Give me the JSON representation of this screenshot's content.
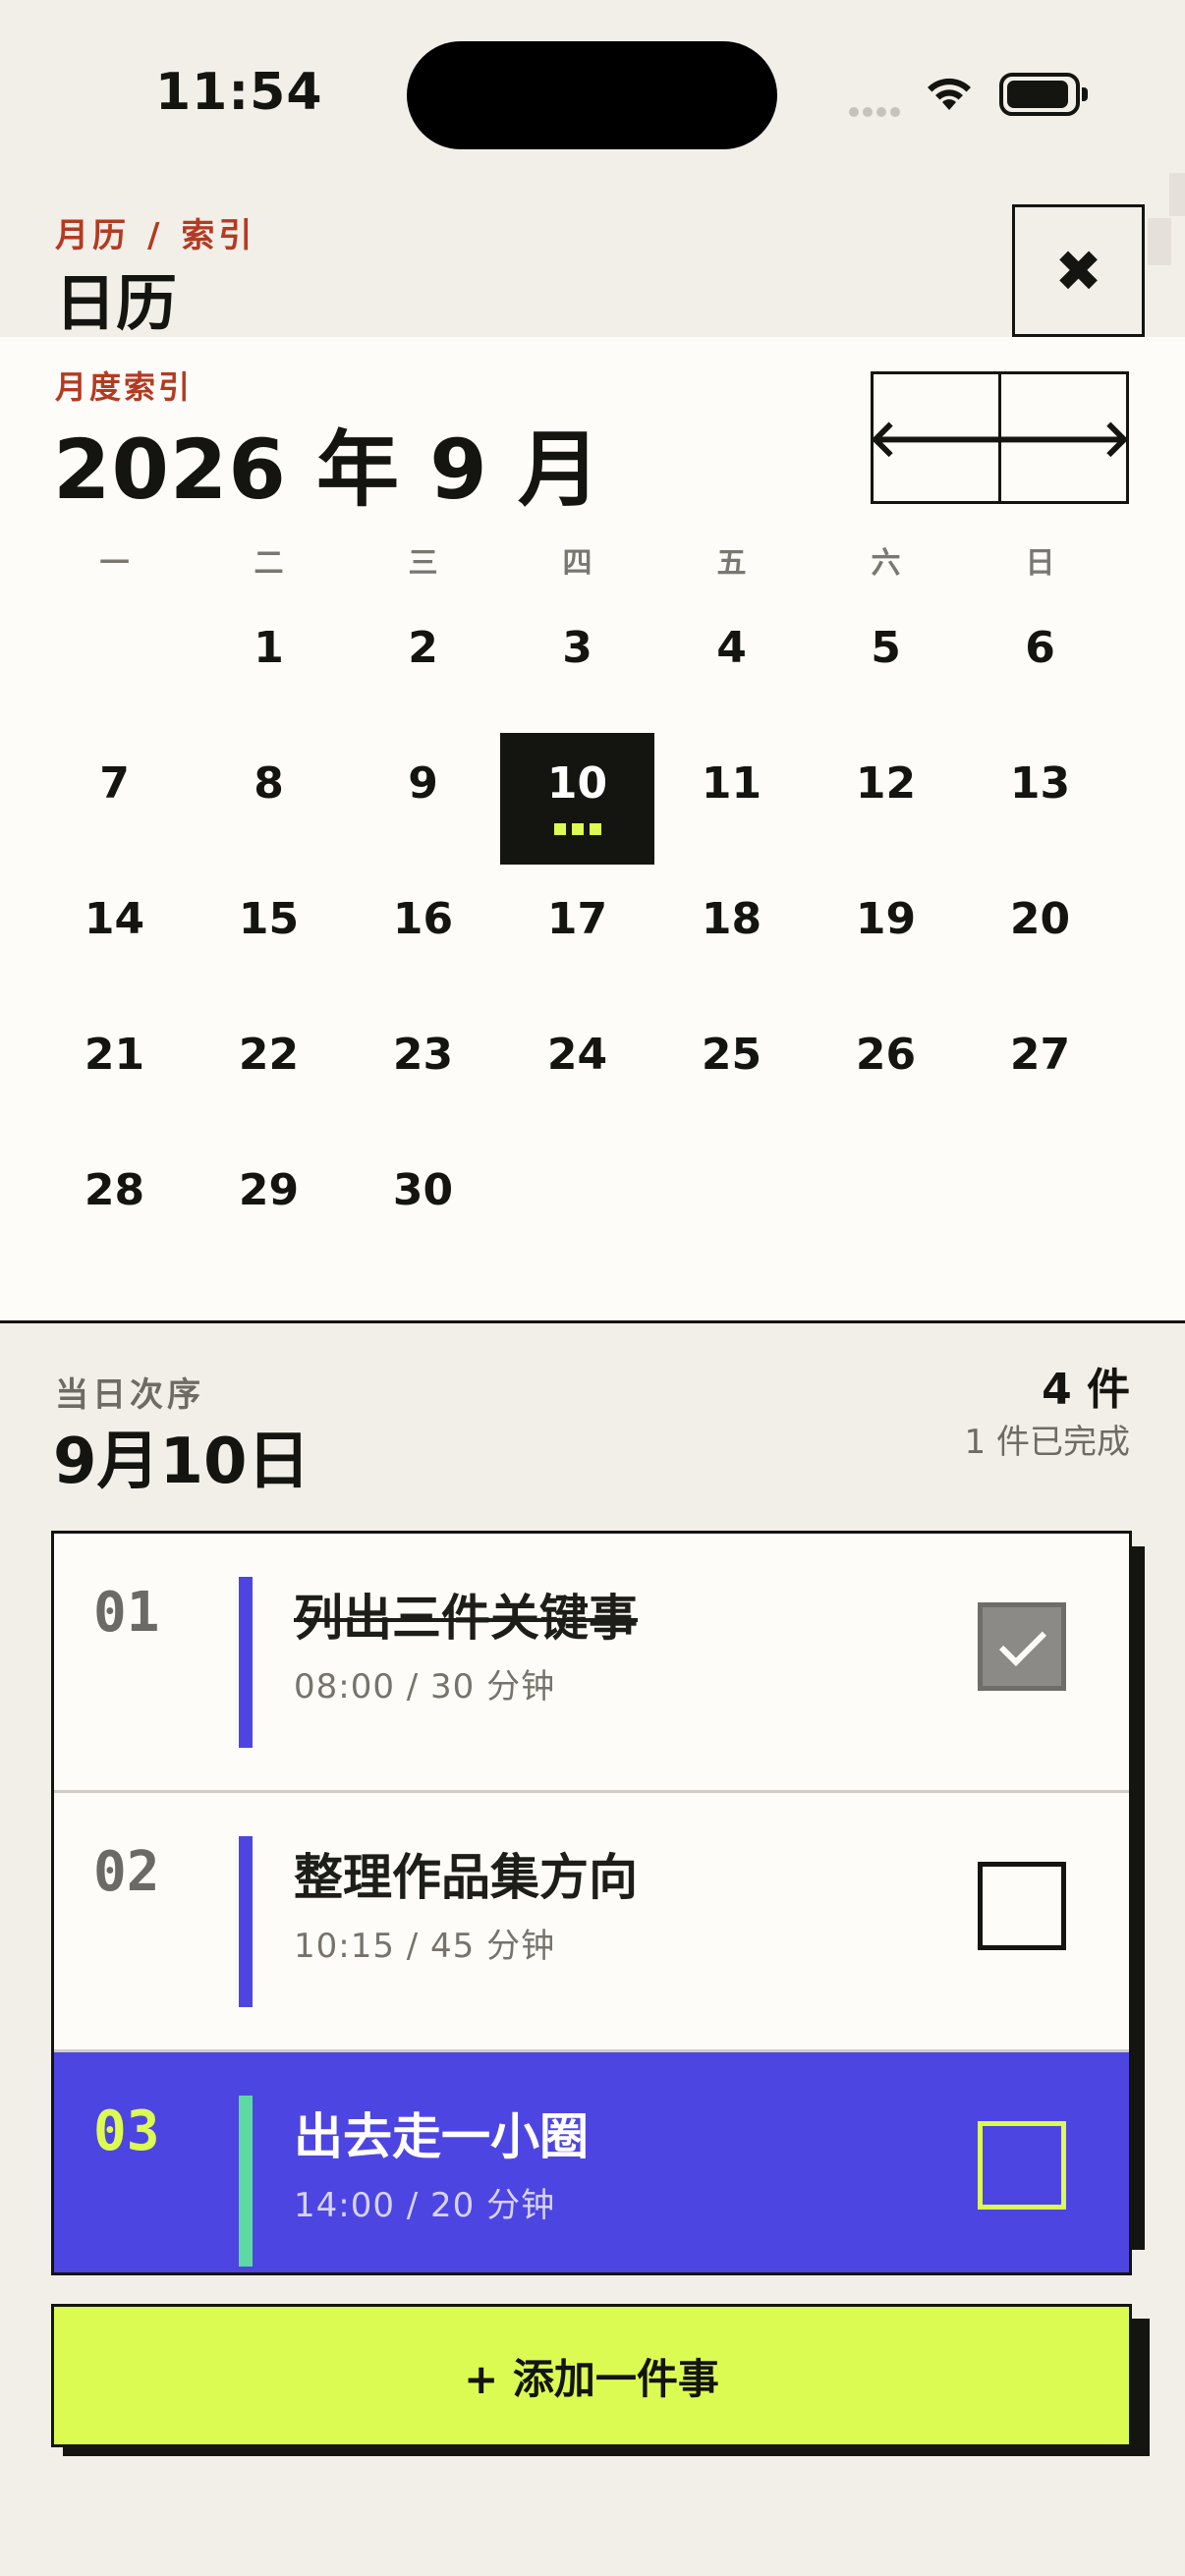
{
  "status_bar": {
    "time": "11:54"
  },
  "header": {
    "breadcrumb": [
      "月历",
      "/",
      "索引"
    ],
    "title": "日历",
    "close_icon": "close-icon"
  },
  "calendar": {
    "kicker": "月度索引",
    "month_title": "2026 年 9 月",
    "prev_icon": "arrow-left-icon",
    "next_icon": "arrow-right-icon",
    "weekdays": [
      "一",
      "二",
      "三",
      "四",
      "五",
      "六",
      "日"
    ],
    "leading_blanks": 1,
    "days_in_month": 30,
    "selected_day": "10"
  },
  "day": {
    "kicker": "当日次序",
    "title": "9月10日",
    "count": "4 件",
    "done_text": "1 件已完成"
  },
  "tasks": [
    {
      "num": "01",
      "name": "列出三件关键事",
      "meta": "08:00 / 30 分钟",
      "done": true,
      "active": false
    },
    {
      "num": "02",
      "name": "整理作品集方向",
      "meta": "10:15 / 45 分钟",
      "done": false,
      "active": false
    },
    {
      "num": "03",
      "name": "出去走一小圈",
      "meta": "14:00 / 20 分钟",
      "done": false,
      "active": true
    }
  ],
  "add_button": {
    "label": "+ 添加一件事"
  },
  "colors": {
    "accent_red": "#b43a22",
    "accent_purple": "#4d45e2",
    "accent_lime": "#dcfb52",
    "accent_mint": "#5fd9a3",
    "ink": "#141410",
    "paper": "#fdfcf8"
  }
}
